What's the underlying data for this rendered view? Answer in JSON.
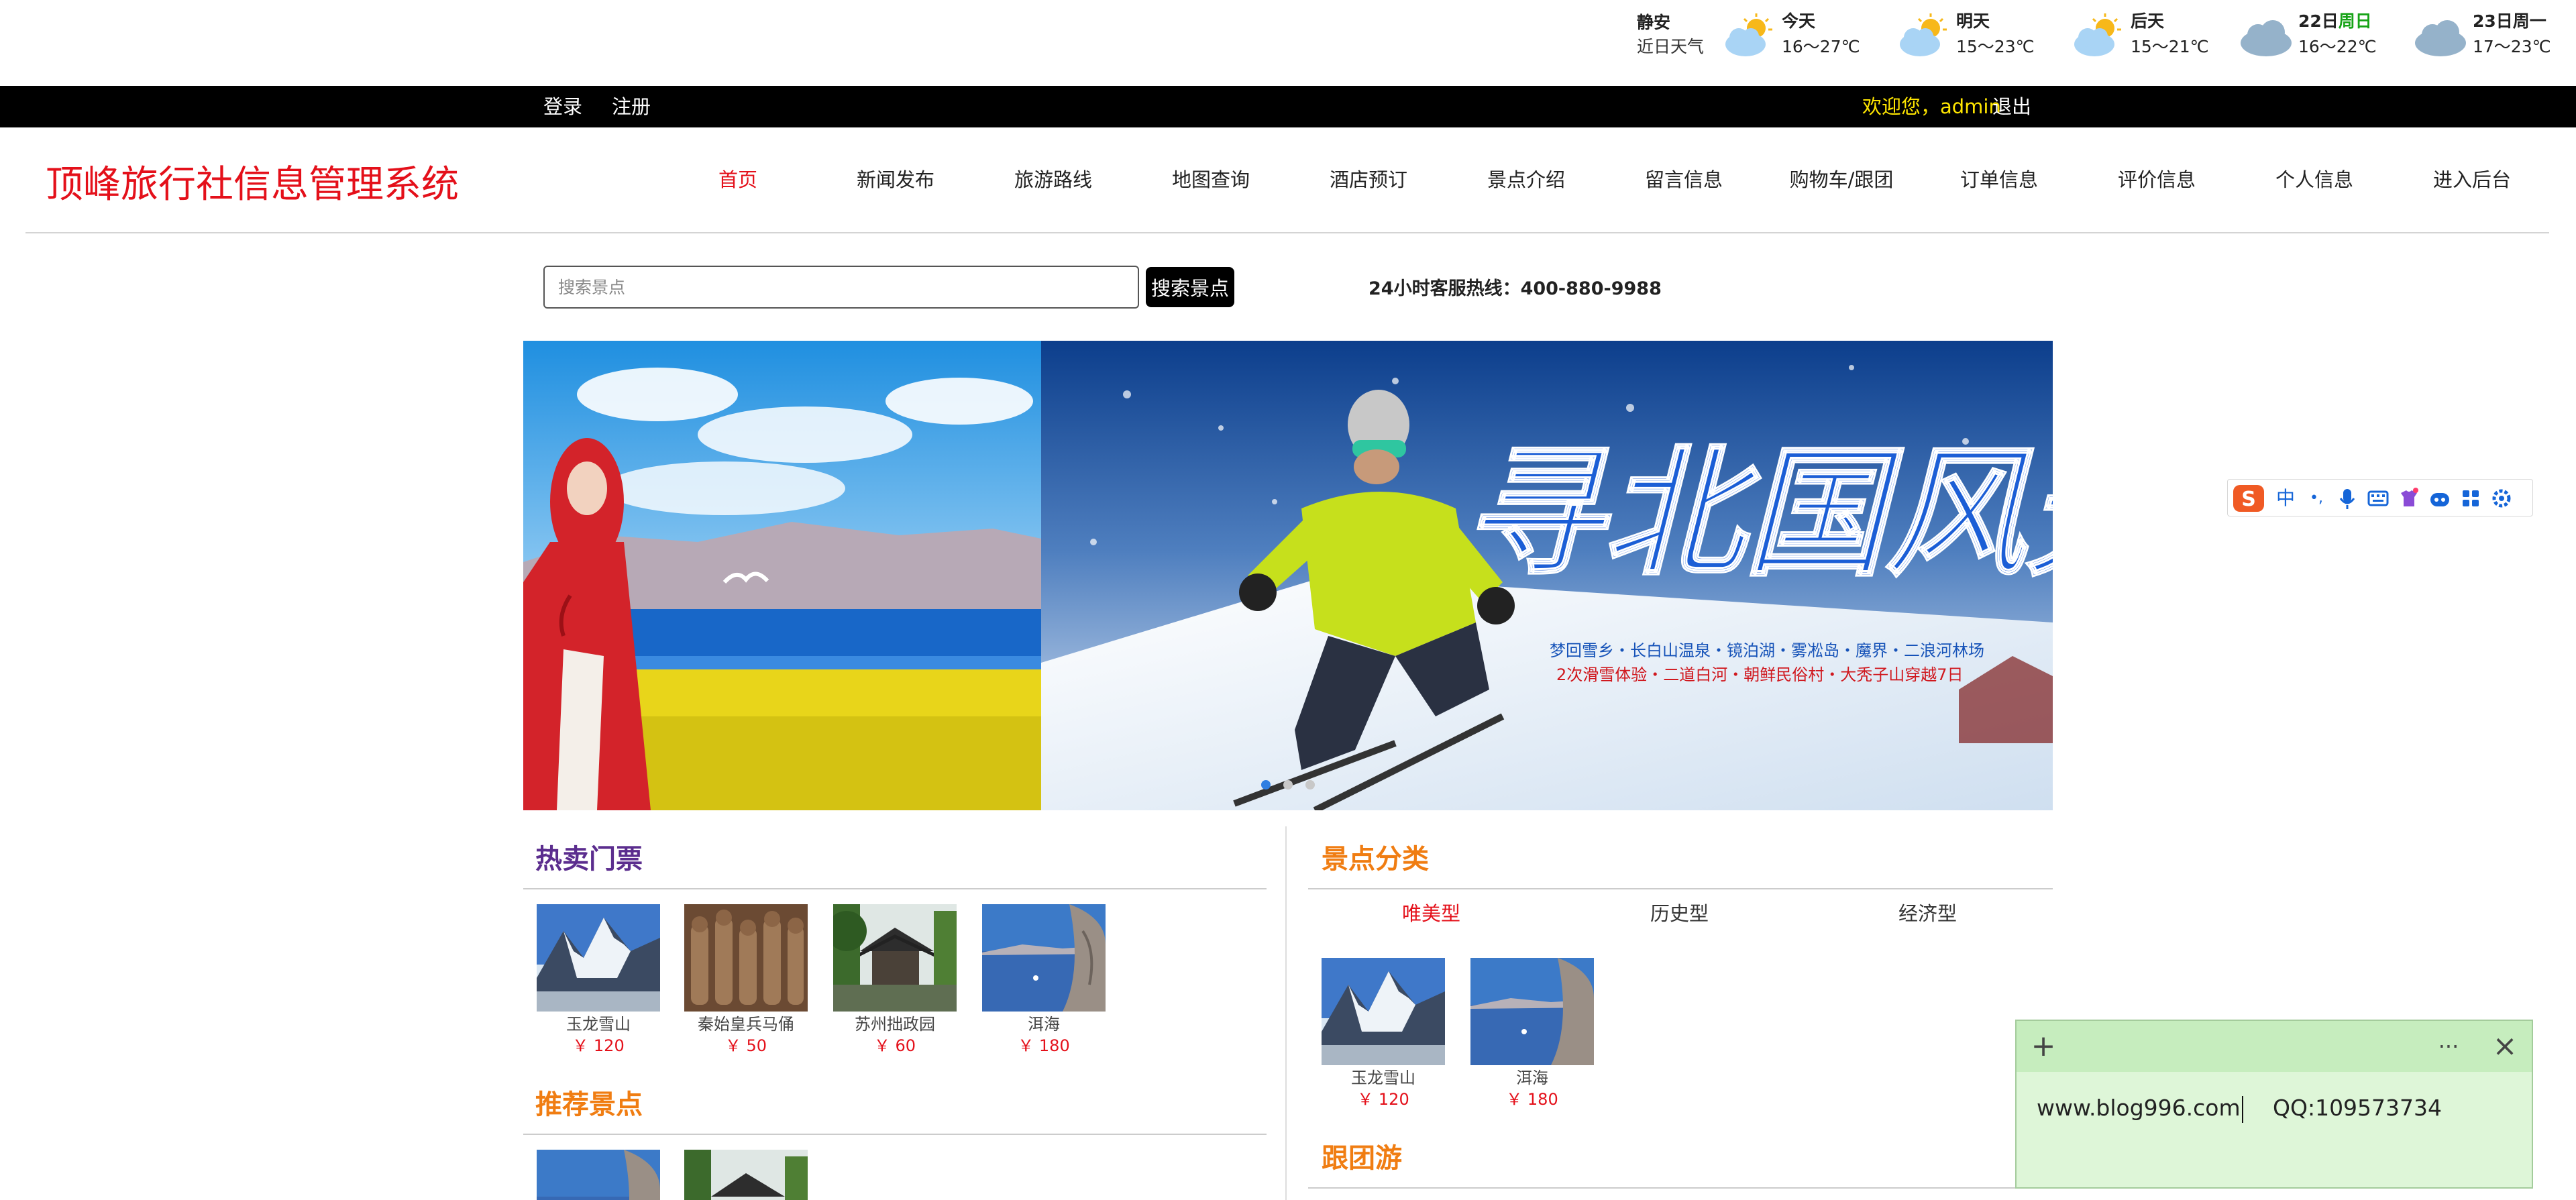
{
  "weather": {
    "city": "静安",
    "caption": "近日天气",
    "days": [
      {
        "label": "今天",
        "label_highlight": "",
        "temp": "16～27℃",
        "icon": "sun-cloud-icon"
      },
      {
        "label": "明天",
        "label_highlight": "",
        "temp": "15～23℃",
        "icon": "sun-cloud-icon"
      },
      {
        "label": "后天",
        "label_highlight": "",
        "temp": "15～21℃",
        "icon": "sun-cloud-icon"
      },
      {
        "label": "22日",
        "label_highlight": "周日",
        "temp": "16～22℃",
        "icon": "cloud-icon"
      },
      {
        "label": "23日周一",
        "label_highlight": "",
        "temp": "17～23℃",
        "icon": "cloud-icon"
      }
    ]
  },
  "topbar": {
    "login": "登录",
    "register": "注册",
    "welcome": "欢迎您，admin",
    "logout": "退出"
  },
  "brand": "顶峰旅行社信息管理系统",
  "nav": {
    "items": [
      "首页",
      "新闻发布",
      "旅游路线",
      "地图查询",
      "酒店预订",
      "景点介绍",
      "留言信息",
      "购物车/跟团",
      "订单信息",
      "评价信息",
      "个人信息",
      "进入后台"
    ],
    "active": "首页"
  },
  "search": {
    "placeholder": "搜索景点",
    "button": "搜索景点"
  },
  "hotline": "24小时客服热线：400-880-9988",
  "banner": {
    "title": "寻北国风光",
    "line1": "梦回雪乡・长白山温泉・镜泊湖・雾凇岛・魔界・二浪河林场",
    "line2": "2次滑雪体验・二道白河・朝鲜民俗村・大秃子山穿越7日",
    "dots": 3,
    "active_dot": 0
  },
  "hot_tickets": {
    "title": "热卖门票",
    "items": [
      {
        "name": "玉龙雪山",
        "price": "￥ 120",
        "thumb": "snow-mountain"
      },
      {
        "name": "秦始皇兵马俑",
        "price": "￥ 50",
        "thumb": "terracotta"
      },
      {
        "name": "苏州拙政园",
        "price": "￥ 60",
        "thumb": "garden"
      },
      {
        "name": "洱海",
        "price": "￥ 180",
        "thumb": "lake"
      }
    ]
  },
  "recommended": {
    "title": "推荐景点",
    "items": [
      {
        "thumb": "lake"
      },
      {
        "thumb": "garden"
      }
    ]
  },
  "categories": {
    "title": "景点分类",
    "tabs": [
      "唯美型",
      "历史型",
      "经济型"
    ],
    "active": "唯美型",
    "items": [
      {
        "name": "玉龙雪山",
        "price": "￥ 120",
        "thumb": "snow-mountain"
      },
      {
        "name": "洱海",
        "price": "￥ 180",
        "thumb": "lake"
      }
    ]
  },
  "group_tour": {
    "title": "跟团游"
  },
  "ime_toolbar": {
    "logo": "S",
    "mode": "中",
    "punct": "•,",
    "icons": [
      "mic-icon",
      "keyboard-icon",
      "skin-icon",
      "robot-icon",
      "grid-icon",
      "settings-icon"
    ]
  },
  "sticky_note": {
    "text": "www.blog996.com",
    "qq": "QQ:109573734",
    "add": "+",
    "more": "···",
    "close": "×"
  },
  "colors": {
    "accent_red": "#e4101a",
    "section_purple": "#5b2d8e",
    "section_orange": "#f07d12",
    "note_bg": "#def6d8"
  }
}
